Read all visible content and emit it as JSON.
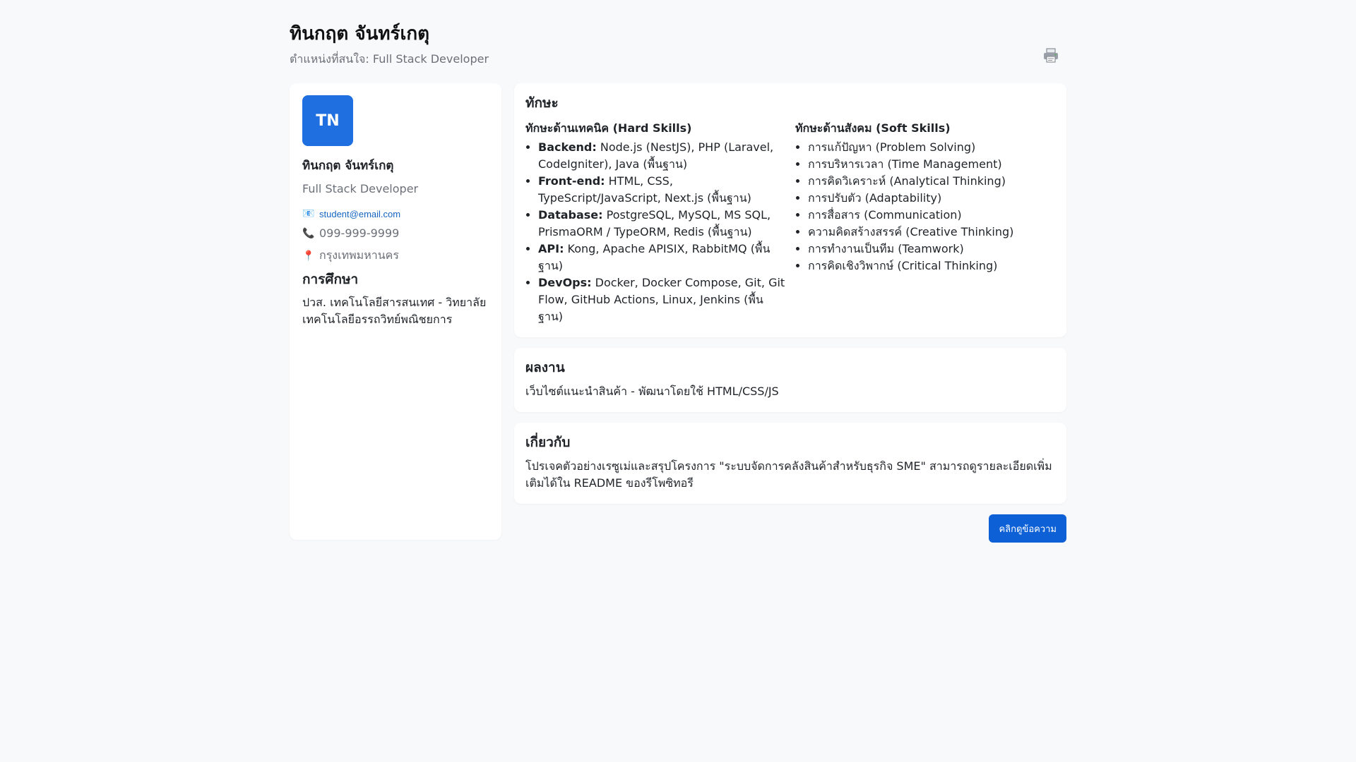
{
  "header": {
    "name": "ทินกฤต จันทร์เกตุ",
    "subtitle": "ตำแหน่งที่สนใจ: Full Stack Developer",
    "print_icon": "printer-icon"
  },
  "sidebar": {
    "avatar_initials": "TN",
    "avatar_color": "#1f6fe0",
    "name": "ทินกฤต จันทร์เกตุ",
    "role": "Full Stack Developer",
    "email_icon": "📧",
    "email": "student@email.com",
    "phone_icon": "📞",
    "phone": "099-999-9999",
    "location_icon": "📍",
    "location": "กรุงเทพมหานคร",
    "education_title": "การศึกษา",
    "education_text": "ปวส. เทคโนโลยีสารสนเทศ - วิทยาลัยเทคโนโลยีอรรถวิทย์พณิชยการ"
  },
  "skills": {
    "title": "ทักษะ",
    "hard_title": "ทักษะด้านเทคนิค (Hard Skills)",
    "hard": [
      {
        "label": "Backend:",
        "text": " Node.js (NestJS), PHP (Laravel, CodeIgniter), Java (พื้นฐาน)"
      },
      {
        "label": "Front-end:",
        "text": " HTML, CSS, TypeScript/JavaScript, Next.js (พื้นฐาน)"
      },
      {
        "label": "Database:",
        "text": " PostgreSQL, MySQL, MS SQL, PrismaORM / TypeORM, Redis (พื้นฐาน)"
      },
      {
        "label": "API:",
        "text": " Kong, Apache APISIX, RabbitMQ (พื้นฐาน)"
      },
      {
        "label": "DevOps:",
        "text": " Docker, Docker Compose, Git, Git Flow, GitHub Actions, Linux, Jenkins (พื้นฐาน)"
      }
    ],
    "soft_title": "ทักษะด้านสังคม (Soft Skills)",
    "soft": [
      "การแก้ปัญหา (Problem Solving)",
      "การบริหารเวลา (Time Management)",
      "การคิดวิเคราะห์ (Analytical Thinking)",
      "การปรับตัว (Adaptability)",
      "การสื่อสาร (Communication)",
      "ความคิดสร้างสรรค์ (Creative Thinking)",
      "การทำงานเป็นทีม (Teamwork)",
      "การคิดเชิงวิพากษ์ (Critical Thinking)"
    ]
  },
  "works": {
    "title": "ผลงาน",
    "text": "เว็บไซต์แนะนำสินค้า - พัฒนาโดยใช้ HTML/CSS/JS"
  },
  "about": {
    "title": "เกี่ยวกับ",
    "text": "โปรเจคตัวอย่างเรซูเม่และสรุปโครงการ \"ระบบจัดการคลังสินค้าสำหรับธุรกิจ SME\" สามารถดูรายละเอียดเพิ่มเติมได้ใน README ของรีโพซิทอรี"
  },
  "actions": {
    "contact_label": "คลิกดูข้อความ"
  },
  "colors": {
    "accent": "#0d60d6",
    "link": "#1565c0",
    "background": "#f8f9fb"
  }
}
